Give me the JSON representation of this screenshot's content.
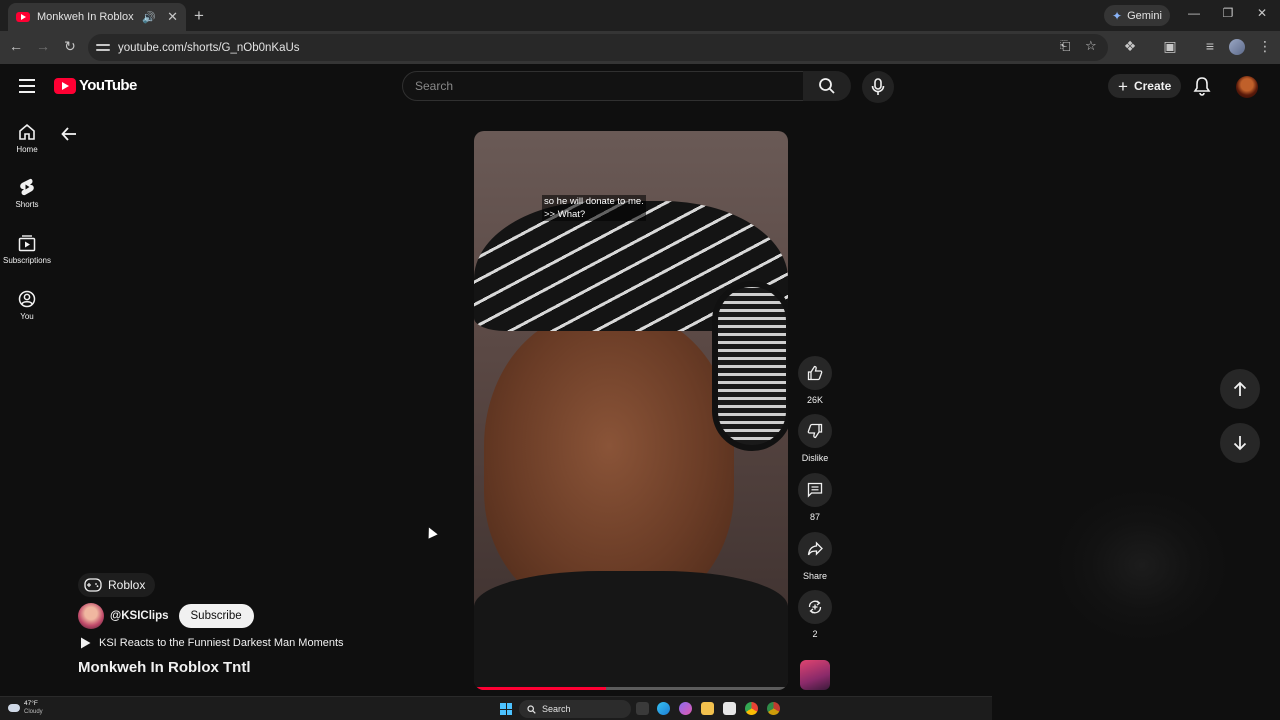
{
  "browser": {
    "tab_title": "Monkweh In Roblox Tntl - Y",
    "gemini_label": "Gemini",
    "url": "youtube.com/shorts/G_nOb0nKaUs"
  },
  "header": {
    "logo_text": "YouTube",
    "search_placeholder": "Search",
    "create_label": "Create"
  },
  "sidebar": {
    "items": [
      {
        "label": "Home"
      },
      {
        "label": "Shorts"
      },
      {
        "label": "Subscriptions"
      },
      {
        "label": "You"
      }
    ]
  },
  "video": {
    "caption_line1": "so he will donate to me.",
    "caption_line2": ">> What?",
    "progress": 0.42
  },
  "actions": {
    "like_count": "26K",
    "dislike_label": "Dislike",
    "comment_count": "87",
    "share_label": "Share",
    "remix_count": "2"
  },
  "info": {
    "tag": "Roblox",
    "channel": "@KSIClips",
    "subscribe_label": "Subscribe",
    "playlist": "KSI Reacts to the Funniest Darkest Man Moments",
    "title": "Monkweh In Roblox Tntl"
  },
  "taskbar": {
    "temperature": "47°F",
    "condition": "Cloudy",
    "search_label": "Search"
  },
  "colors": {
    "brand_red": "#ff0033",
    "background": "#0f0f0f",
    "chip": "#272727"
  }
}
